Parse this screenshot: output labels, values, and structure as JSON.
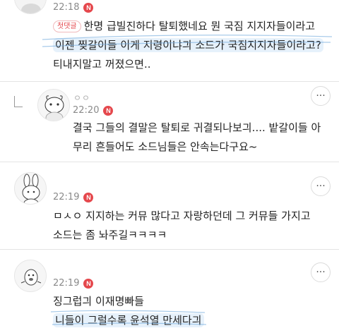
{
  "comments": [
    {
      "time": "22:18",
      "badge": "N",
      "first_label": "첫댓글",
      "lines": [
        "한명 급빌진하다 탈퇴했네요 뭔 국짐 지지자들이라고",
        "이젠 찢갈이들 이게 지령이냐긔 소드가 국짐지지자들이라고?",
        "티내지말고 꺼졌으면.."
      ]
    },
    {
      "time": "22:20",
      "badge": "N",
      "username": "ㅇㅇ",
      "more": "···",
      "lines": [
        "결국 그들의 결말은 탈퇴로 귀결되나보긔.... 밭갈이들 아",
        "무리 흔들어도 소드님들은 안속는다구요~"
      ]
    },
    {
      "time": "22:19",
      "badge": "N",
      "more": "···",
      "lines": [
        "ㅁㅅㅇ 지지하는 커뮤 많다고 자랑하던데 그 커뮤들 가지고",
        "소드는 좀 놔주길ㅋㅋㅋㅋ"
      ]
    },
    {
      "time": "22:19",
      "badge": "N",
      "more": "···",
      "lines": [
        "징그럽긔 이재명빠들",
        "니들이 그럴수록 윤석열 만세다긔"
      ]
    }
  ],
  "colors": {
    "badge": "#e5484d",
    "highlight": "#e6f1fb",
    "scribble": "#6ea8dc"
  },
  "icons": {
    "more": "more-horizontal-icon",
    "reply": "reply-arrow-icon",
    "new": "new-badge-icon"
  }
}
